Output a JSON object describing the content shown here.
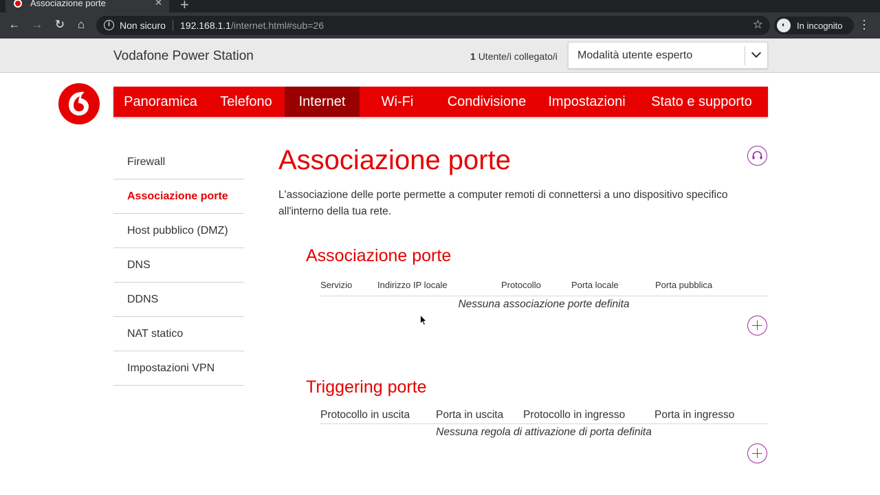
{
  "browser": {
    "tab_title": "Associazione porte",
    "tab_close": "✕",
    "new_tab": "+",
    "security_label": "Non sicuro",
    "url_host": "192.168.1.1",
    "url_path": "/internet.html#sub=26",
    "profile_label": "In incognito"
  },
  "header": {
    "product_name": "Vodafone Power Station",
    "users_count": "1",
    "users_label": "Utente/i collegato/i",
    "mode_selected": "Modalità utente esperto"
  },
  "nav": {
    "items": [
      {
        "label": "Panoramica"
      },
      {
        "label": "Telefono"
      },
      {
        "label": "Internet"
      },
      {
        "label": "Wi-Fi"
      },
      {
        "label": "Condivisione"
      },
      {
        "label": "Impostazioni"
      },
      {
        "label": "Stato e supporto"
      }
    ],
    "active": "Internet"
  },
  "sidebar": {
    "items": [
      {
        "label": "Firewall"
      },
      {
        "label": "Associazione porte"
      },
      {
        "label": "Host pubblico (DMZ)"
      },
      {
        "label": "DNS"
      },
      {
        "label": "DDNS"
      },
      {
        "label": "NAT statico"
      },
      {
        "label": "Impostazioni VPN"
      }
    ],
    "active": "Associazione porte"
  },
  "main": {
    "title": "Associazione porte",
    "intro": "L'associazione delle porte permette a computer remoti di connettersi a uno dispositivo specifico all'interno della tua rete.",
    "port_mapping": {
      "title": "Associazione porte",
      "columns": [
        "Servizio",
        "Indirizzo IP locale",
        "Protocollo",
        "Porta locale",
        "Porta pubblica"
      ],
      "empty_message": "Nessuna associazione porte definita"
    },
    "port_triggering": {
      "title": "Triggering porte",
      "columns": [
        "Protocollo in uscita",
        "Porta in uscita",
        "Protocollo in ingresso",
        "Porta in ingresso"
      ],
      "empty_message": "Nessuna regola di attivazione di porta definita"
    }
  },
  "colors": {
    "brand_red": "#e60000",
    "nav_active": "#990000",
    "accent_purple": "#9c2aa0"
  }
}
